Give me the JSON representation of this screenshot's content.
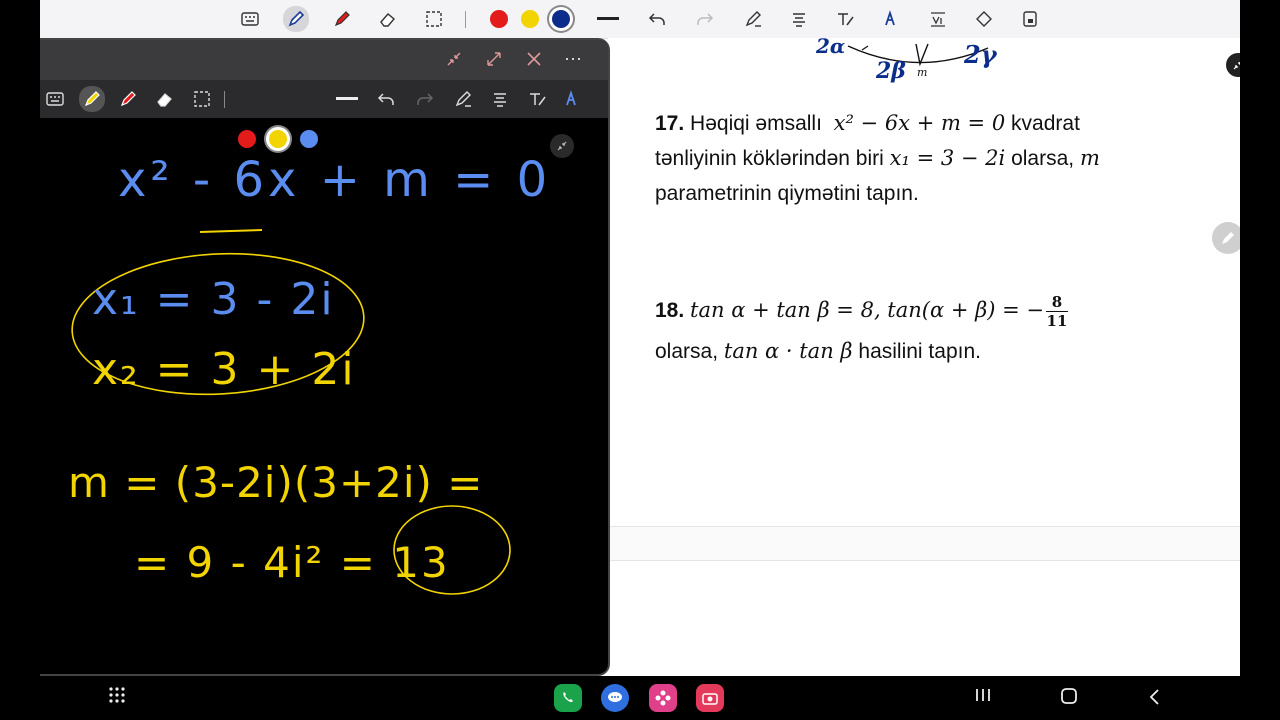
{
  "toolbar": {
    "colors": {
      "red": "#e31b1b",
      "yellow": "#f2d400",
      "blue": "#0b2e8a"
    }
  },
  "float_window": {
    "colors": {
      "red": "#e31b1b",
      "yellow": "#f2d400",
      "blue": "#5b8df0"
    },
    "handwriting": {
      "eq_line": "x² - 6x + m = 0",
      "root1": "x₁ = 3 - 2i",
      "root2": "x₂ = 3 + 2i",
      "product": "m = (3-2i)(3+2i) =",
      "result": "= 9 - 4i² = 13"
    }
  },
  "document": {
    "q17": {
      "number": "17.",
      "text_a": "Həqiqi əmsallı",
      "eq": "x² − 6x + m = 0",
      "text_b": "kvadrat",
      "text_c": "tənliyinin köklərindən biri",
      "root": "x₁ = 3 − 2i",
      "text_d": "olarsa,",
      "param": "m",
      "text_e": "parametrinin qiymətini tapın."
    },
    "q18": {
      "number": "18.",
      "eq_a": "tan α + tan β = 8, tan(α + β) = −",
      "frac_num": "8",
      "frac_den": "11",
      "text_a": "olarsa,",
      "eq_b": "tan α · tan β",
      "text_b": "hasilini tapın."
    },
    "top_sketch": {
      "label_a": "2α",
      "label_b": "2β",
      "label_m": "m",
      "label_c": "2γ"
    }
  },
  "navbar": {
    "apps": [
      "phone-app",
      "messages-app",
      "bixby-app",
      "camera-app"
    ]
  }
}
